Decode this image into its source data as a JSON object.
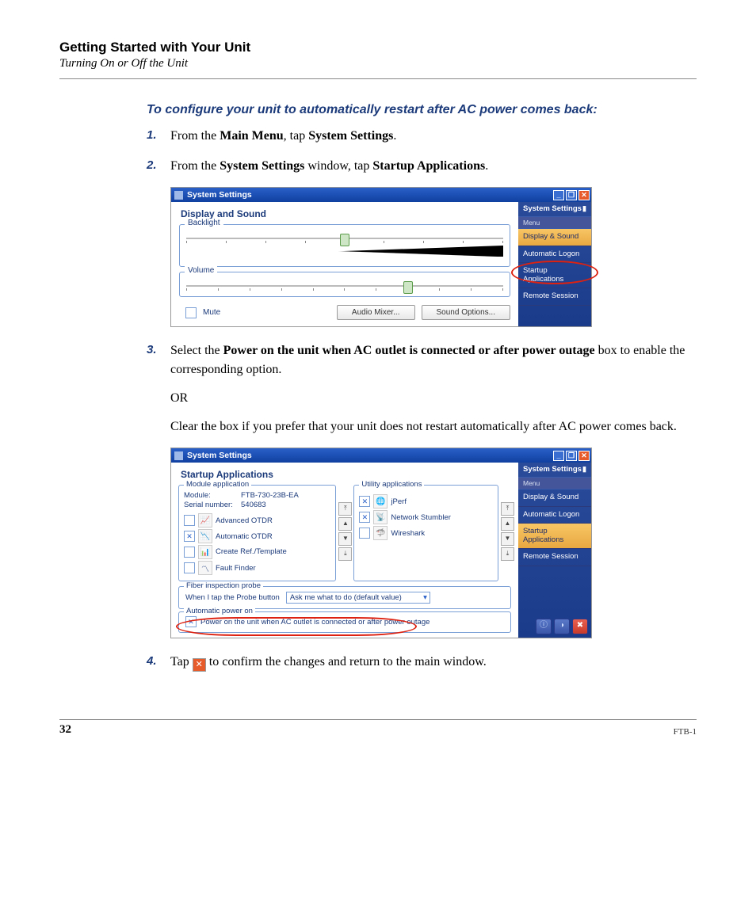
{
  "header": {
    "chapter": "Getting Started with Your Unit",
    "section": "Turning On or Off the Unit"
  },
  "task_intro": "To configure your unit to automatically restart after AC power comes back:",
  "steps": {
    "s1": {
      "num": "1.",
      "a": "From the ",
      "b1": "Main Menu",
      "c": ", tap ",
      "b2": "System Settings",
      "d": "."
    },
    "s2": {
      "num": "2.",
      "a": "From the ",
      "b1": "System Settings",
      "c": " window, tap ",
      "b2": "Startup Applications",
      "d": "."
    },
    "s3": {
      "num": "3.",
      "a": "Select the ",
      "b1": "Power on the unit when AC outlet is connected or after power outage",
      "c": " box to enable the corresponding option.",
      "or": "OR",
      "d": "Clear the box if you prefer that your unit does not restart automatically after AC power comes back."
    },
    "s4": {
      "num": "4.",
      "a": "Tap ",
      "b": " to confirm the changes and return to the main window."
    }
  },
  "fig1": {
    "title": "System Settings",
    "panel_head": "Display and Sound",
    "backlight": "Backlight",
    "volume": "Volume",
    "mute": "Mute",
    "audio_mixer": "Audio Mixer...",
    "sound_options": "Sound Options...",
    "sidebar": {
      "head": "System Settings",
      "menu": "Menu",
      "items": [
        "Display & Sound",
        "Automatic Logon",
        "Startup Applications",
        "Remote Session"
      ],
      "active_index": 0
    }
  },
  "fig2": {
    "title": "System Settings",
    "panel_head": "Startup Applications",
    "module_col_legend": "Module application",
    "module_label": "Module:",
    "module_value": "FTB-730-23B-EA",
    "serial_label": "Serial number:",
    "serial_value": "540683",
    "module_apps": [
      {
        "checked": false,
        "name": "Advanced OTDR"
      },
      {
        "checked": true,
        "name": "Automatic OTDR"
      },
      {
        "checked": false,
        "name": "Create Ref./Template"
      },
      {
        "checked": false,
        "name": "Fault Finder"
      }
    ],
    "utility_legend": "Utility applications",
    "utility_apps": [
      {
        "checked": true,
        "name": "jPerf"
      },
      {
        "checked": true,
        "name": "Network Stumbler"
      },
      {
        "checked": false,
        "name": "Wireshark"
      }
    ],
    "fiber": {
      "legend": "Fiber inspection probe",
      "label": "When I tap the Probe button",
      "value": "Ask me what to do  (default value)"
    },
    "auto_power": {
      "legend": "Automatic power on",
      "label": "Power on the unit when AC outlet is connected or after power outage",
      "checked": true
    },
    "sidebar": {
      "head": "System Settings",
      "menu": "Menu",
      "items": [
        "Display & Sound",
        "Automatic Logon",
        "Startup Applications",
        "Remote Session"
      ],
      "active_index": 2
    }
  },
  "footer": {
    "page": "32",
    "model": "FTB-1"
  }
}
